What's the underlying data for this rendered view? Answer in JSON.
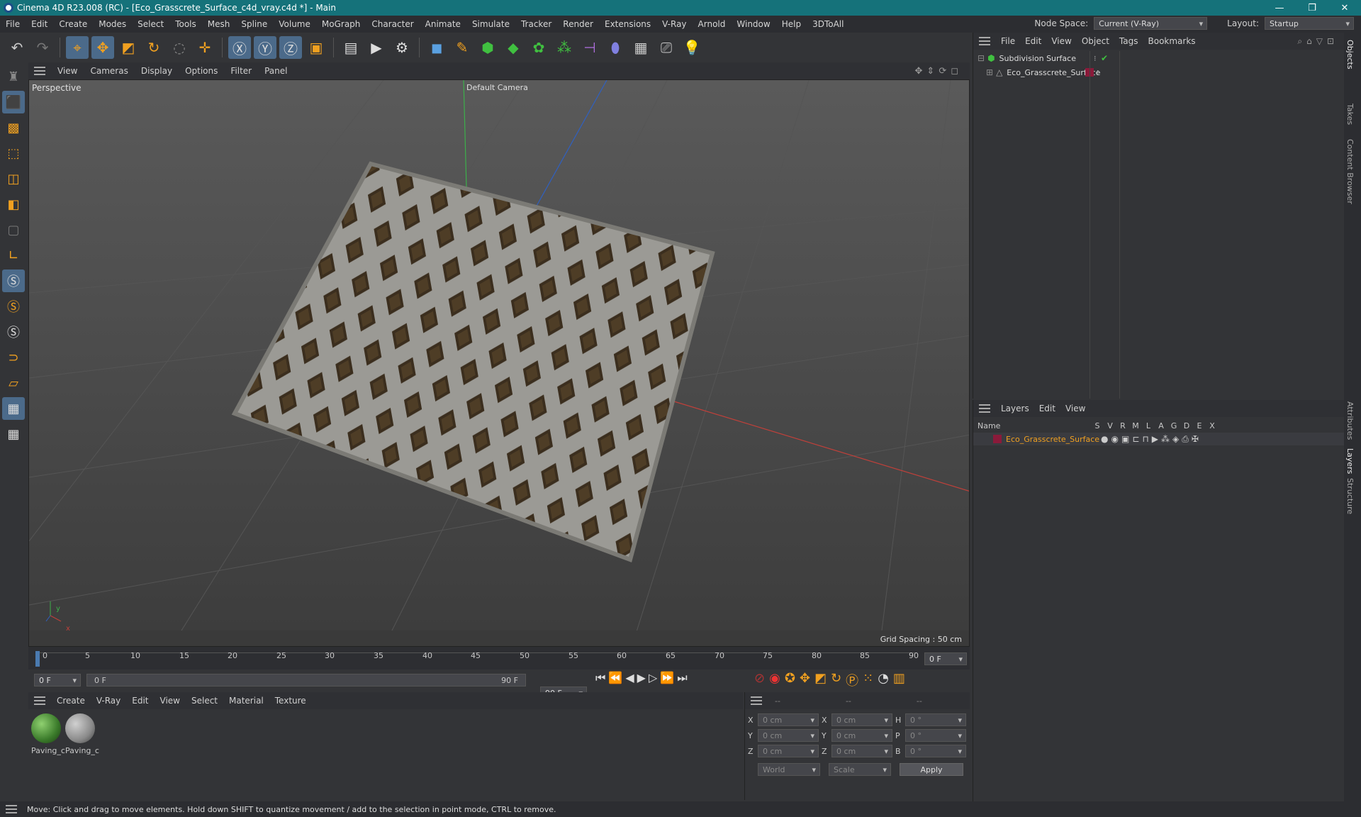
{
  "window": {
    "title": "Cinema 4D R23.008 (RC) - [Eco_Grasscrete_Surface_c4d_vray.c4d *] - Main",
    "min": "—",
    "restore": "❐",
    "close": "✕"
  },
  "menubar": {
    "items": [
      "File",
      "Edit",
      "Create",
      "Modes",
      "Select",
      "Tools",
      "Mesh",
      "Spline",
      "Volume",
      "MoGraph",
      "Character",
      "Animate",
      "Simulate",
      "Tracker",
      "Render",
      "Extensions",
      "V-Ray",
      "Arnold",
      "Window",
      "Help",
      "3DToAll"
    ],
    "node_space_label": "Node Space:",
    "node_space_value": "Current (V-Ray)",
    "layout_label": "Layout:",
    "layout_value": "Startup"
  },
  "viewport": {
    "menu": [
      "View",
      "Cameras",
      "Display",
      "Options",
      "Filter",
      "Panel"
    ],
    "name": "Perspective",
    "camera": "Default Camera",
    "grid_spacing": "Grid Spacing : 50 cm",
    "axis_y": "y",
    "axis_x": "x"
  },
  "timeline": {
    "ticks": [
      "0",
      "5",
      "10",
      "15",
      "20",
      "25",
      "30",
      "35",
      "40",
      "45",
      "50",
      "55",
      "60",
      "65",
      "70",
      "75",
      "80",
      "85",
      "90"
    ],
    "current_frame": "0 F",
    "start_field": "0 F",
    "range_start": "0 F",
    "range_end": "90 F",
    "end_field": "90 F"
  },
  "materials": {
    "menu": [
      "Create",
      "V-Ray",
      "Edit",
      "View",
      "Select",
      "Material",
      "Texture"
    ],
    "items": [
      {
        "label": "Paving_c",
        "color": "#3a7a2a"
      },
      {
        "label": "Paving_c",
        "color": "#8a8a8a"
      }
    ]
  },
  "coords": {
    "header": [
      "--",
      "--",
      "--"
    ],
    "rows": [
      {
        "a": "X",
        "av": "0 cm",
        "b": "X",
        "bv": "0 cm",
        "c": "H",
        "cv": "0 °"
      },
      {
        "a": "Y",
        "av": "0 cm",
        "b": "Y",
        "bv": "0 cm",
        "c": "P",
        "cv": "0 °"
      },
      {
        "a": "Z",
        "av": "0 cm",
        "b": "Z",
        "bv": "0 cm",
        "c": "B",
        "cv": "0 °"
      }
    ],
    "world": "World",
    "scale": "Scale",
    "apply": "Apply"
  },
  "objects": {
    "menu": [
      "File",
      "Edit",
      "View",
      "Object",
      "Tags",
      "Bookmarks"
    ],
    "items": [
      {
        "name": "Subdivision Surface"
      },
      {
        "name": "Eco_Grasscrete_Surface"
      }
    ]
  },
  "layers": {
    "menu": [
      "Layers",
      "Edit",
      "View"
    ],
    "name_header": "Name",
    "cols": [
      "S",
      "V",
      "R",
      "M",
      "L",
      "A",
      "G",
      "D",
      "E",
      "X"
    ],
    "items": [
      {
        "name": "Eco_Grasscrete_Surface",
        "color": "#8a1a3a"
      }
    ]
  },
  "sidetabs": [
    "Objects",
    "Takes",
    "Content Browser",
    "Attributes",
    "Layers",
    "Structure"
  ],
  "status": "Move: Click and drag to move elements. Hold down SHIFT to quantize movement / add to the selection in point mode, CTRL to remove."
}
